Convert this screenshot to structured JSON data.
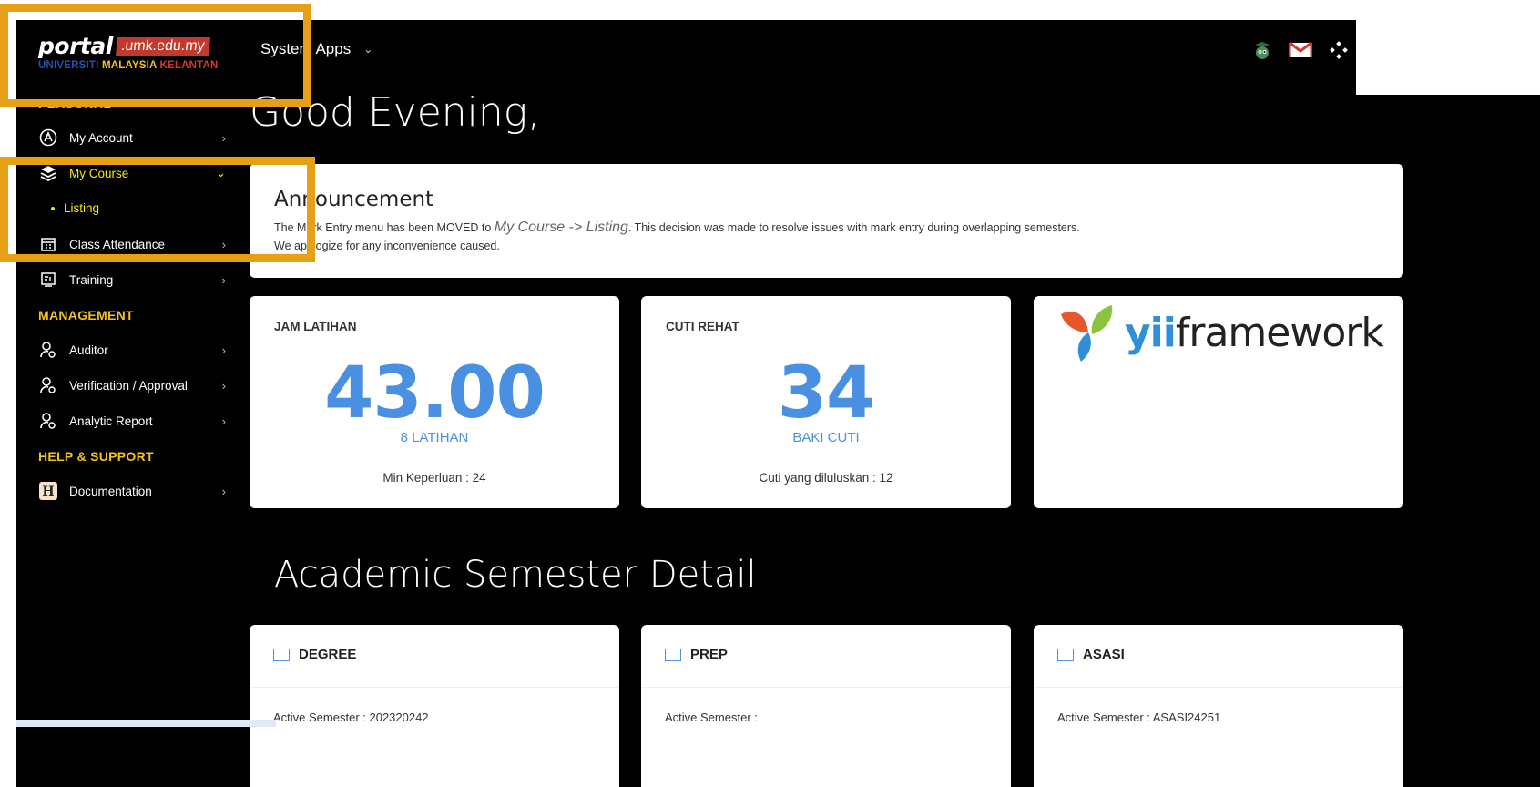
{
  "brand": {
    "portal": "portal",
    "domain": ".umk.edu.my",
    "uni_1": "UNIVERSITI",
    "uni_2": "MALAYSIA",
    "uni_3": "KELANTAN"
  },
  "sidebar": {
    "personal_title": "PERSONAL",
    "management_title": "MANAGEMENT",
    "help_title": "HELP & SUPPORT",
    "items": [
      {
        "label": "My Account",
        "icon": "account-icon"
      },
      {
        "label": "My Course",
        "icon": "layers-icon"
      },
      {
        "label": "Class Attendance",
        "icon": "calendar-icon"
      },
      {
        "label": "Training",
        "icon": "board-icon"
      },
      {
        "label": "Auditor",
        "icon": "user-key-icon"
      },
      {
        "label": "Verification / Approval",
        "icon": "user-key-icon"
      },
      {
        "label": "Analytic Report",
        "icon": "user-key-icon"
      },
      {
        "label": "Documentation",
        "icon": "h-icon"
      }
    ],
    "sub_listing": "Listing"
  },
  "topbar": {
    "system_apps": "System Apps",
    "icons": [
      "owl-icon",
      "mail-icon",
      "apps-icon"
    ]
  },
  "greeting": "Good Evening,",
  "announcement": {
    "title": "Announcement",
    "line1_a": "The Mark Entry menu has been MOVED to ",
    "line1_link": "My Course -> Listing",
    "line1_b": ". This decision was made to resolve issues with mark entry during overlapping semesters.",
    "line2": "We apologize for any inconvenience caused."
  },
  "stats": [
    {
      "label": "JAM LATIHAN",
      "value": "43.00",
      "sub": "8 LATIHAN",
      "foot": "Min Keperluan : 24"
    },
    {
      "label": "CUTI REHAT",
      "value": "34",
      "sub": "BAKI CUTI",
      "foot": "Cuti yang diluluskan : 12"
    }
  ],
  "yii": {
    "prefix": "yii",
    "rest": "framework"
  },
  "academic_title": "Academic Semester Detail",
  "semesters": [
    {
      "title": "DEGREE",
      "active": "Active Semester : 202320242"
    },
    {
      "title": "PREP",
      "active": "Active Semester :"
    },
    {
      "title": "ASASI",
      "active": "Active Semester : ASASI24251"
    }
  ],
  "colors": {
    "accent_yellow": "#f4e61a",
    "highlight": "#e6a016",
    "stat_blue": "#4a90e2"
  }
}
